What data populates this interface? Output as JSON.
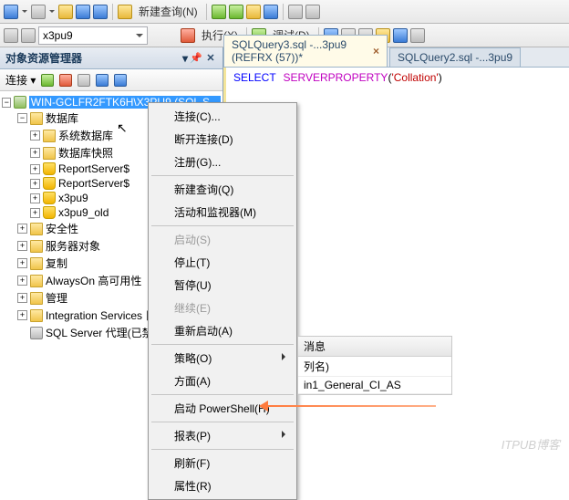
{
  "toolbar": {
    "new_query": "新建查询(N)",
    "execute": "执行(X)",
    "debug": "调试(D)",
    "combo_db": "x3pu9"
  },
  "panel": {
    "title": "对象资源管理器",
    "connect_label": "连接 ▾"
  },
  "tree": {
    "root": "WIN-GCLFR2FTK6H\\X3PU9 (SQL S...",
    "databases": "数据库",
    "sys_db": "系统数据库",
    "db_snapshot": "数据库快照",
    "rs1": "ReportServer$",
    "rs2": "ReportServer$",
    "db1": "x3pu9",
    "db2": "x3pu9_old",
    "security": "安全性",
    "server_obj": "服务器对象",
    "replication": "复制",
    "alwayson": "AlwaysOn 高可用性",
    "management": "管理",
    "is": "Integration Services 目录",
    "agent": "SQL Server 代理(已禁用代理 XP)"
  },
  "tabs": {
    "t1": "SQLQuery3.sql -...3pu9 (REFRX (57))*",
    "t2": "SQLQuery2.sql -...3pu9"
  },
  "sql": {
    "kw": "SELECT",
    "fn": "SERVERPROPERTY",
    "paren_open": "(",
    "str": "'Collation'",
    "paren_close": ")"
  },
  "ctx": {
    "connect": "连接(C)...",
    "disconnect": "断开连接(D)",
    "register": "注册(G)...",
    "newquery": "新建查询(Q)",
    "activity": "活动和监视器(M)",
    "start": "启动(S)",
    "stop": "停止(T)",
    "pause": "暂停(U)",
    "resume": "继续(E)",
    "restart": "重新启动(A)",
    "policies": "策略(O)",
    "facets": "方面(A)",
    "powershell": "启动 PowerShell(H)",
    "reports": "报表(P)",
    "refresh": "刷新(F)",
    "properties": "属性(R)"
  },
  "results": {
    "tab": "消息",
    "col": "列名)",
    "val": "in1_General_CI_AS"
  },
  "watermark": "ITPUB博客"
}
